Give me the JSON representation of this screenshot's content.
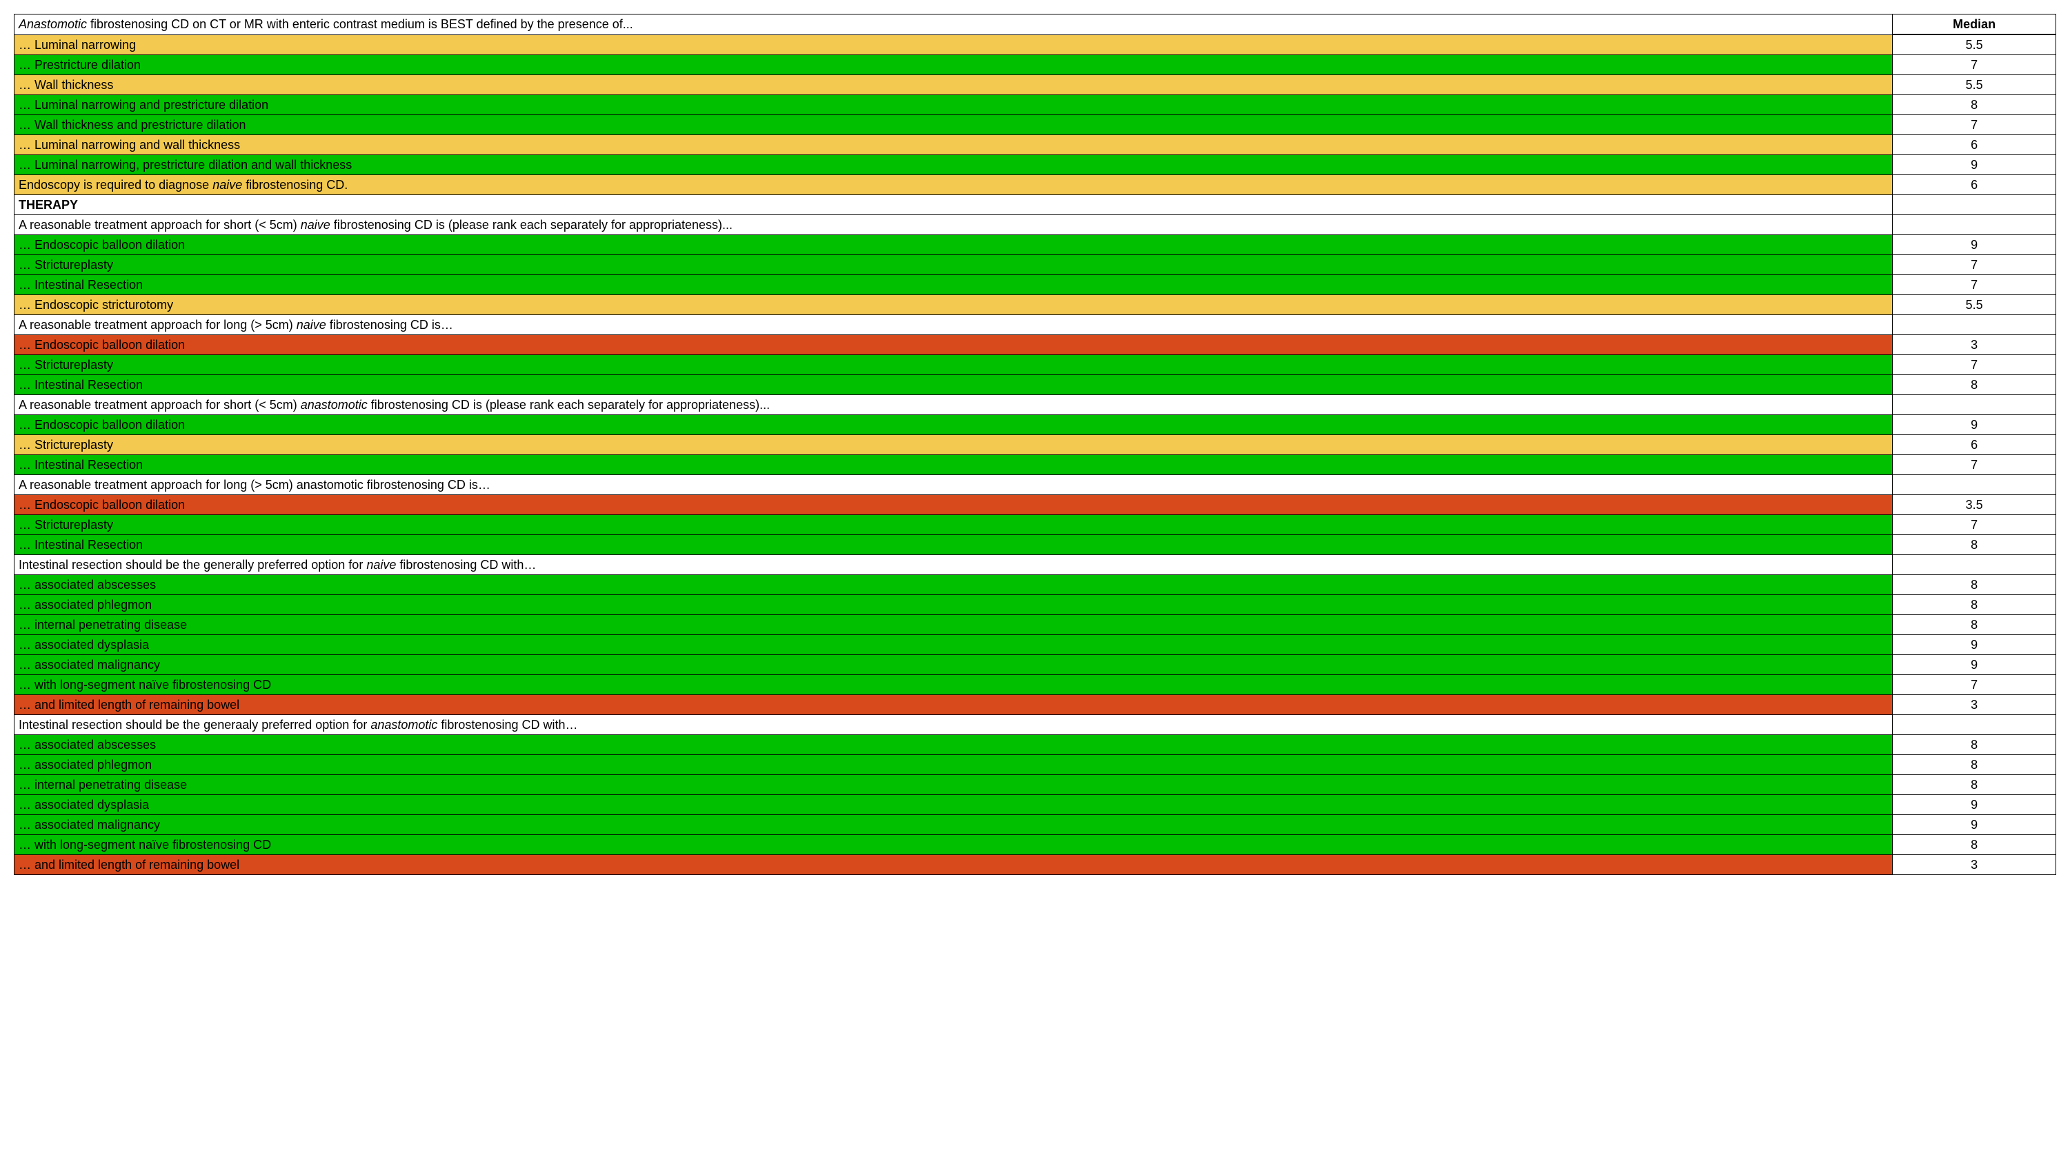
{
  "header": {
    "median": "Median"
  },
  "rows": [
    {
      "color": "white",
      "segments": [
        {
          "t": "Anastomotic",
          "i": true
        },
        {
          "t": " fibrostenosing CD on CT or MR with enteric contrast medium is BEST defined by the presence of..."
        }
      ],
      "median": ""
    },
    {
      "color": "yellow",
      "segments": [
        {
          "t": "… Luminal narrowing"
        }
      ],
      "median": "5.5"
    },
    {
      "color": "green",
      "segments": [
        {
          "t": "…  Prestricture dilation"
        }
      ],
      "median": "7"
    },
    {
      "color": "yellow",
      "segments": [
        {
          "t": "… Wall thickness"
        }
      ],
      "median": "5.5"
    },
    {
      "color": "green",
      "segments": [
        {
          "t": "… Luminal narrowing and prestricture dilation"
        }
      ],
      "median": "8"
    },
    {
      "color": "green",
      "segments": [
        {
          "t": "… Wall thickness and prestricture dilation"
        }
      ],
      "median": "7"
    },
    {
      "color": "yellow",
      "segments": [
        {
          "t": "… Luminal narrowing and wall thickness"
        }
      ],
      "median": "6"
    },
    {
      "color": "green",
      "segments": [
        {
          "t": "… Luminal narrowing, prestricture dilation and wall thickness"
        }
      ],
      "median": "9"
    },
    {
      "color": "yellow",
      "segments": [
        {
          "t": "Endoscopy is required to diagnose "
        },
        {
          "t": "naive",
          "i": true
        },
        {
          "t": " fibrostenosing CD."
        }
      ],
      "median": "6"
    },
    {
      "color": "white",
      "segments": [
        {
          "t": "THERAPY",
          "b": true
        }
      ],
      "median": ""
    },
    {
      "color": "white",
      "segments": [
        {
          "t": "A reasonable treatment approach for short (< 5cm) "
        },
        {
          "t": "naive",
          "i": true
        },
        {
          "t": " fibrostenosing CD is (please rank each separately for appropriateness)..."
        }
      ],
      "median": ""
    },
    {
      "color": "green",
      "segments": [
        {
          "t": "… Endoscopic balloon dilation"
        }
      ],
      "median": "9"
    },
    {
      "color": "green",
      "segments": [
        {
          "t": "… Strictureplasty"
        }
      ],
      "median": "7"
    },
    {
      "color": "green",
      "segments": [
        {
          "t": "… Intestinal Resection"
        }
      ],
      "median": "7"
    },
    {
      "color": "yellow",
      "segments": [
        {
          "t": "… Endoscopic stricturotomy"
        }
      ],
      "median": "5.5"
    },
    {
      "color": "white",
      "segments": [
        {
          "t": "A reasonable treatment approach for long (> 5cm) "
        },
        {
          "t": "naive",
          "i": true
        },
        {
          "t": " fibrostenosing CD is…"
        }
      ],
      "median": ""
    },
    {
      "color": "red",
      "segments": [
        {
          "t": "… Endoscopic balloon dilation"
        }
      ],
      "median": "3"
    },
    {
      "color": "green",
      "segments": [
        {
          "t": "… Strictureplasty"
        }
      ],
      "median": "7"
    },
    {
      "color": "green",
      "segments": [
        {
          "t": "… Intestinal Resection"
        }
      ],
      "median": "8"
    },
    {
      "color": "white",
      "segments": [
        {
          "t": "A reasonable treatment approach for short (< 5cm) "
        },
        {
          "t": "anastomotic",
          "i": true
        },
        {
          "t": " fibrostenosing CD is (please rank each separately for appropriateness)..."
        }
      ],
      "median": ""
    },
    {
      "color": "green",
      "segments": [
        {
          "t": "… Endoscopic balloon dilation"
        }
      ],
      "median": "9"
    },
    {
      "color": "yellow",
      "segments": [
        {
          "t": "… Strictureplasty"
        }
      ],
      "median": "6"
    },
    {
      "color": "green",
      "segments": [
        {
          "t": "… Intestinal Resection"
        }
      ],
      "median": "7"
    },
    {
      "color": "white",
      "segments": [
        {
          "t": "A reasonable treatment approach for long (> 5cm) anastomotic fibrostenosing CD is…"
        }
      ],
      "median": ""
    },
    {
      "color": "red",
      "segments": [
        {
          "t": "… Endoscopic balloon dilation"
        }
      ],
      "median": "3.5"
    },
    {
      "color": "green",
      "segments": [
        {
          "t": "… Strictureplasty"
        }
      ],
      "median": "7"
    },
    {
      "color": "green",
      "segments": [
        {
          "t": "… Intestinal Resection"
        }
      ],
      "median": "8"
    },
    {
      "color": "white",
      "segments": [
        {
          "t": "Intestinal resection should be the generally preferred option for "
        },
        {
          "t": "naive",
          "i": true
        },
        {
          "t": " fibrostenosing CD with…"
        }
      ],
      "median": ""
    },
    {
      "color": "green",
      "segments": [
        {
          "t": "… associated abscesses"
        }
      ],
      "median": "8"
    },
    {
      "color": "green",
      "segments": [
        {
          "t": "… associated phlegmon"
        }
      ],
      "median": "8"
    },
    {
      "color": "green",
      "segments": [
        {
          "t": "… internal penetrating disease"
        }
      ],
      "median": "8"
    },
    {
      "color": "green",
      "segments": [
        {
          "t": "… associated dysplasia"
        }
      ],
      "median": "9"
    },
    {
      "color": "green",
      "segments": [
        {
          "t": "… associated malignancy"
        }
      ],
      "median": "9"
    },
    {
      "color": "green",
      "segments": [
        {
          "t": "… with long-segment naïve fibrostenosing CD"
        }
      ],
      "median": "7"
    },
    {
      "color": "red",
      "segments": [
        {
          "t": "… and limited length of remaining bowel"
        }
      ],
      "median": "3"
    },
    {
      "color": "white",
      "segments": [
        {
          "t": "Intestinal resection should be the generaaly preferred option for "
        },
        {
          "t": "anastomotic",
          "i": true
        },
        {
          "t": " fibrostenosing CD with…"
        }
      ],
      "median": ""
    },
    {
      "color": "green",
      "segments": [
        {
          "t": "… associated abscesses"
        }
      ],
      "median": "8"
    },
    {
      "color": "green",
      "segments": [
        {
          "t": "… associated phlegmon"
        }
      ],
      "median": "8"
    },
    {
      "color": "green",
      "segments": [
        {
          "t": "… internal penetrating disease"
        }
      ],
      "median": "8"
    },
    {
      "color": "green",
      "segments": [
        {
          "t": "… associated dysplasia"
        }
      ],
      "median": "9"
    },
    {
      "color": "green",
      "segments": [
        {
          "t": "… associated malignancy"
        }
      ],
      "median": "9"
    },
    {
      "color": "green",
      "segments": [
        {
          "t": "… with long-segment naïve fibrostenosing CD"
        }
      ],
      "median": "8"
    },
    {
      "color": "red",
      "segments": [
        {
          "t": "… and limited length of remaining bowel"
        }
      ],
      "median": "3"
    }
  ]
}
